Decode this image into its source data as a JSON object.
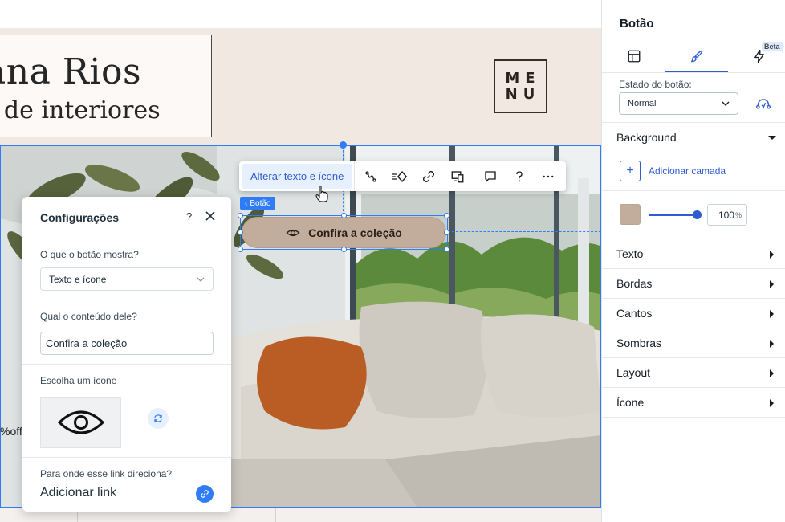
{
  "site": {
    "name_title": "ana Rios",
    "name_subtitle": "r de interiores",
    "menu_logo": [
      "ME",
      "NU"
    ],
    "off_text": "%off"
  },
  "selected_button": {
    "tag_label": "Botão",
    "label": "Confira a coleção",
    "icon": "eye-icon",
    "color": "#c2ad9c"
  },
  "toolbar": {
    "change_label": "Alterar texto e ícone",
    "icons": [
      "animation-icon",
      "interactions-icon",
      "link-icon",
      "responsive-icon",
      "comment-icon",
      "help-icon",
      "more-icon"
    ]
  },
  "settings": {
    "title": "Configurações",
    "help": "?",
    "show_label": "O que o botão mostra?",
    "show_value": "Texto e ícone",
    "content_label": "Qual o conteúdo dele?",
    "content_value": "Confira a coleção",
    "icon_label": "Escolha um ícone",
    "link_label": "Para onde esse link direciona?",
    "link_title": "Adicionar link"
  },
  "inspector": {
    "title": "Botão",
    "tabs": [
      "layout-icon",
      "design-brush-icon",
      "interactions-bolt-icon"
    ],
    "active_tab": 1,
    "beta": "Beta",
    "state_label": "Estado do botão:",
    "state_value": "Normal",
    "background_title": "Background",
    "add_layer": "Adicionar camada",
    "fill_color": "#c2ad9c",
    "opacity_value": "100",
    "opacity_unit": "%",
    "opacity_level": 1.0,
    "sections": [
      "Texto",
      "Bordas",
      "Cantos",
      "Sombras",
      "Layout",
      "Ícone"
    ],
    "accent_color": "#2f5dd0"
  }
}
